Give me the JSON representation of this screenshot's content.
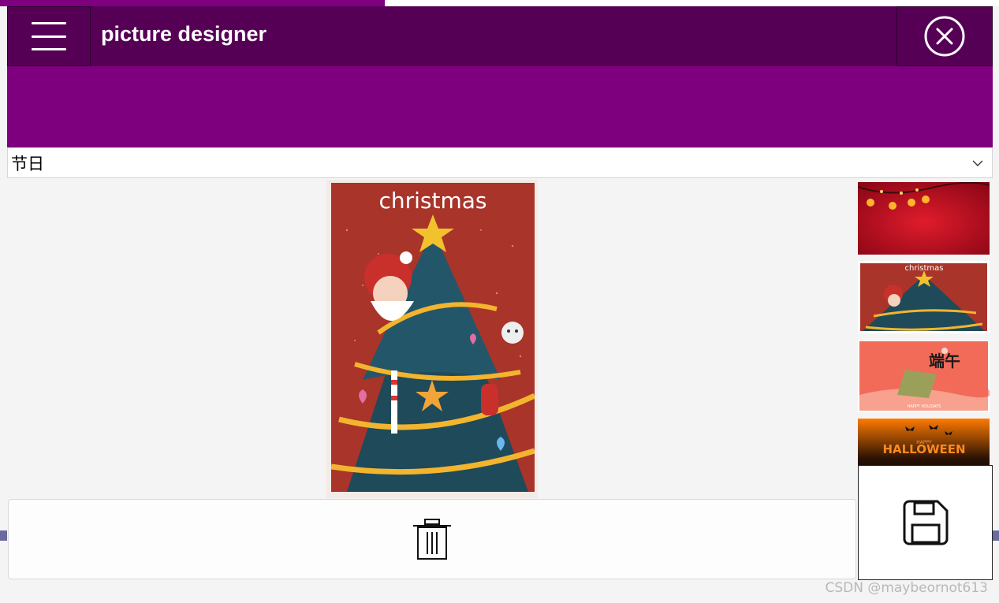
{
  "app": {
    "title": "picture designer"
  },
  "category_select": {
    "selected": "节日"
  },
  "poster": {
    "heading": "christmas"
  },
  "thumbnails": [
    {
      "name": "red-lanterns",
      "text": ""
    },
    {
      "name": "christmas",
      "text": "christmas"
    },
    {
      "name": "duanwu",
      "text": "端午"
    },
    {
      "name": "halloween",
      "text": "HALLOWEEN"
    }
  ],
  "thumb_duanwu_sub": "HAPPY HOLIDAYS",
  "thumb_halloween_top": "HAPPY",
  "watermark": "CSDN @maybeornot613",
  "icons": {
    "menu": "hamburger-icon",
    "close": "close-circle-icon",
    "dropdown": "chevron-down-icon",
    "trash": "trash-icon",
    "save": "floppy-disk-icon"
  },
  "colors": {
    "titlebar": "#560055",
    "banner": "#7e007e",
    "background": "#f4f4f4"
  }
}
